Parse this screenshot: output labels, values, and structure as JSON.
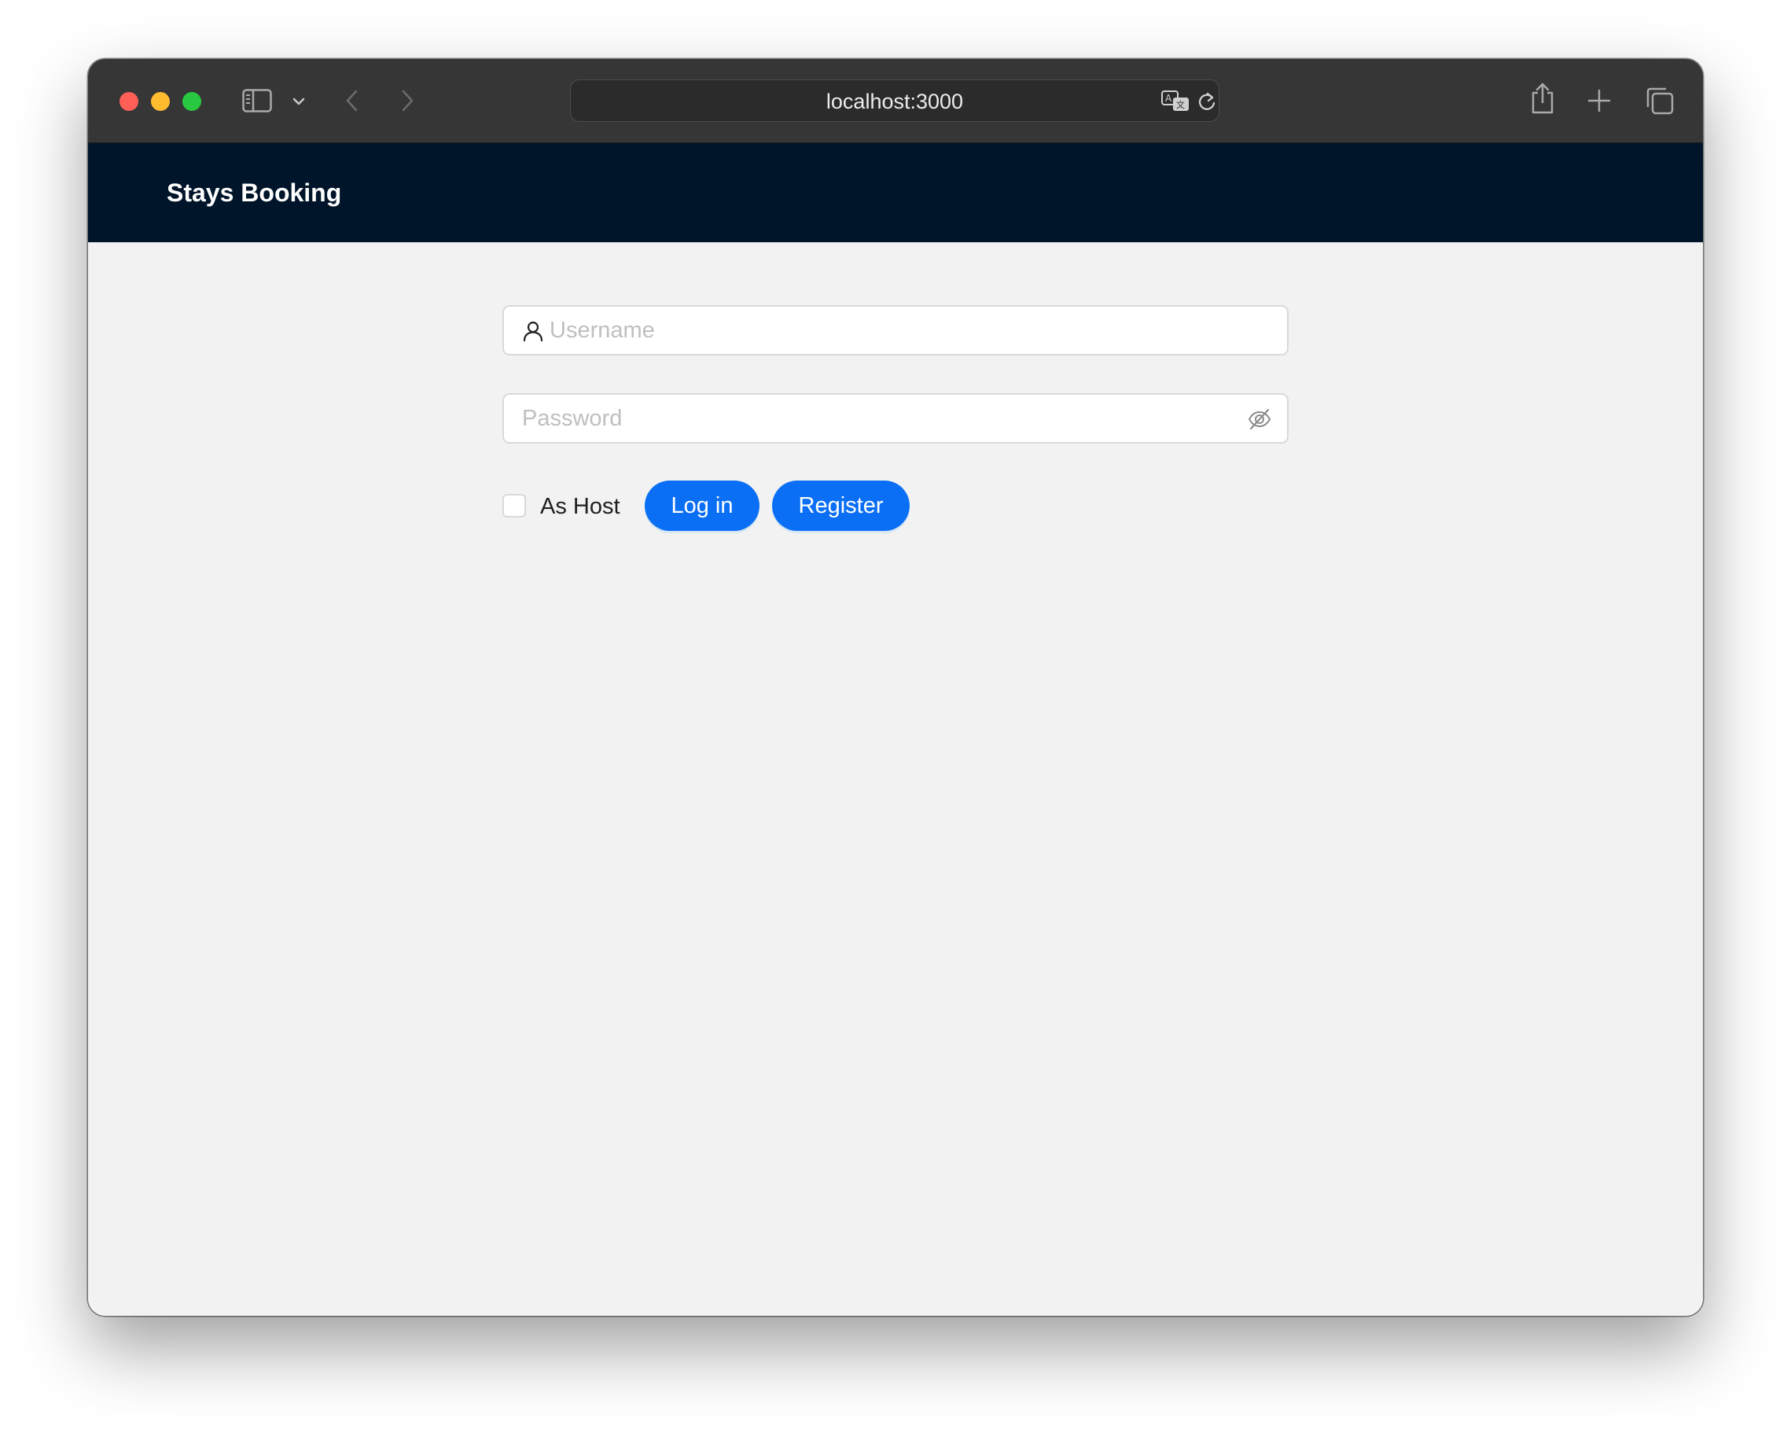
{
  "browser": {
    "url": "localhost:3000",
    "icons": {
      "sidebar": "sidebar-icon",
      "sidebar_menu": "chevron-down-icon",
      "back": "chevron-left-icon",
      "forward": "chevron-right-icon",
      "translate": "translate-icon",
      "reload": "reload-icon",
      "share": "share-icon",
      "new_tab": "plus-icon",
      "tabs": "tabs-overview-icon"
    }
  },
  "header": {
    "brand": "Stays Booking",
    "background": "#001529"
  },
  "login_form": {
    "username": {
      "placeholder": "Username",
      "value": "",
      "icon": "user-icon"
    },
    "password": {
      "placeholder": "Password",
      "value": "",
      "icon": "eye-invisible-icon"
    },
    "as_host": {
      "label": "As Host",
      "checked": false
    },
    "login_button": "Log in",
    "register_button": "Register"
  },
  "colors": {
    "primary": "#0a6ff5",
    "page_background": "#f2f2f2",
    "titlebar": "#363636"
  }
}
